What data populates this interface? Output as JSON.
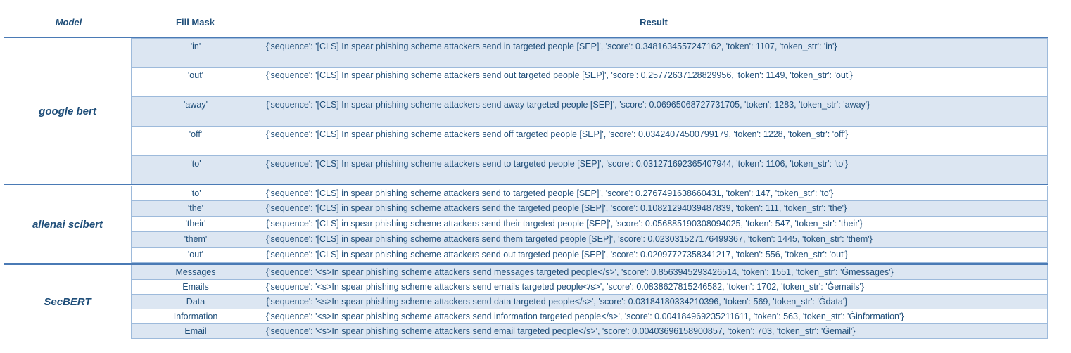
{
  "headers": {
    "model": "Model",
    "fill_mask": "Fill Mask",
    "result": "Result"
  },
  "groups": [
    {
      "model": "google bert",
      "rows": [
        {
          "mask": "'in'",
          "result": "{'sequence': '[CLS] In spear phishing scheme attackers send in targeted people [SEP]', 'score': 0.3481634557247162, 'token': 1107, 'token_str': 'in'}"
        },
        {
          "mask": "'out'",
          "result": "{'sequence': '[CLS] In spear phishing scheme attackers send out targeted people [SEP]', 'score': 0.25772637128829956, 'token': 1149, 'token_str': 'out'}"
        },
        {
          "mask": "'away'",
          "result": "{'sequence': '[CLS] In spear phishing scheme attackers send away targeted people [SEP]', 'score': 0.06965068727731705, 'token': 1283, 'token_str': 'away'}"
        },
        {
          "mask": "'off'",
          "result": "{'sequence': '[CLS] In spear phishing scheme attackers send off targeted people [SEP]', 'score': 0.03424074500799179, 'token': 1228, 'token_str': 'off'}"
        },
        {
          "mask": "'to'",
          "result": "{'sequence': '[CLS] In spear phishing scheme attackers send to targeted people [SEP]', 'score': 0.031271692365407944, 'token': 1106, 'token_str': 'to'}"
        }
      ]
    },
    {
      "model": "allenai scibert",
      "rows": [
        {
          "mask": "'to'",
          "result": "{'sequence': '[CLS] in spear phishing scheme attackers send to targeted people [SEP]', 'score': 0.2767491638660431, 'token': 147, 'token_str': 'to'}"
        },
        {
          "mask": "'the'",
          "result": "{'sequence': '[CLS] in spear phishing scheme attackers send the targeted people [SEP]', 'score': 0.10821294039487839, 'token': 111, 'token_str': 'the'}"
        },
        {
          "mask": "'their'",
          "result": "{'sequence': '[CLS] in spear phishing scheme attackers send their targeted people [SEP]', 'score': 0.056885190308094025, 'token': 547, 'token_str': 'their'}"
        },
        {
          "mask": "'them'",
          "result": "{'sequence': '[CLS] in spear phishing scheme attackers send them targeted people [SEP]', 'score': 0.023031527176499367, 'token': 1445, 'token_str': 'them'}"
        },
        {
          "mask": "'out'",
          "result": "{'sequence': '[CLS] in spear phishing scheme attackers send out targeted people [SEP]', 'score': 0.02097727358341217, 'token': 556, 'token_str': 'out'}"
        }
      ]
    },
    {
      "model": "SecBERT",
      "rows": [
        {
          "mask": "Messages",
          "result": "{'sequence': '<s>In spear phishing scheme attackers send messages targeted people</s>', 'score': 0.8563945293426514, 'token': 1551, 'token_str': 'Ġmessages'}"
        },
        {
          "mask": "Emails",
          "result": "{'sequence': '<s>In spear phishing scheme attackers send emails targeted people</s>', 'score': 0.0838627815246582, 'token': 1702, 'token_str': 'Ġemails'}"
        },
        {
          "mask": "Data",
          "result": "{'sequence': '<s>In spear phishing scheme attackers send data targeted people</s>', 'score': 0.03184180334210396, 'token': 569, 'token_str': 'Ġdata'}"
        },
        {
          "mask": "Information",
          "result": "{'sequence': '<s>In spear phishing scheme attackers send information targeted people</s>', 'score': 0.004184969235211611, 'token': 563, 'token_str': 'Ġinformation'}"
        },
        {
          "mask": "Email",
          "result": "{'sequence': '<s>In spear phishing scheme attackers send email targeted people</s>', 'score': 0.00403696158900857, 'token': 703, 'token_str': 'Ġemail'}"
        }
      ]
    }
  ]
}
